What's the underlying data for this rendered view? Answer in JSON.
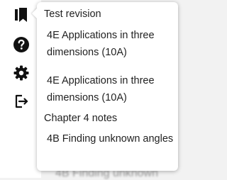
{
  "rail": {
    "icons": [
      "bookmark-icon",
      "help-icon",
      "gear-icon",
      "logout-icon"
    ]
  },
  "menu": {
    "heading_test_revision": "Test revision",
    "item_1": "4E Applications in three dimensions (10A)",
    "item_2": "4E Applications in three dimensions (10A)",
    "heading_chapter_notes": "Chapter 4 notes",
    "item_3": "4B Finding unknown angles"
  },
  "background": {
    "partial_text": "4B Finding unknown"
  },
  "colors": {
    "icon": "#111111",
    "text": "#222222",
    "popover_bg": "#ffffff"
  }
}
